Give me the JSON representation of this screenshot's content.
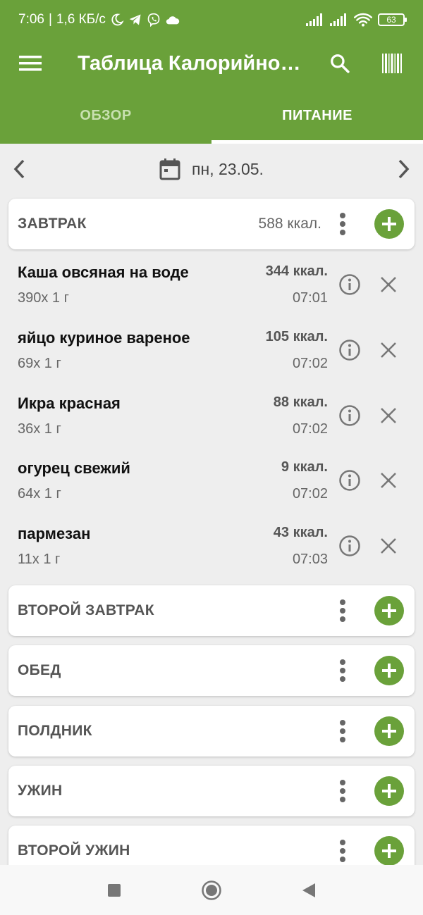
{
  "status": {
    "time": "7:06",
    "speed": "1,6 КБ/с",
    "battery": "63",
    "icons": [
      "moon-icon",
      "telegram-icon",
      "viber-icon",
      "cloud-icon",
      "signal-icon",
      "signal-icon",
      "wifi-icon",
      "battery-icon"
    ]
  },
  "appbar": {
    "title": "Таблица Калорийно…",
    "icons": [
      "menu-icon",
      "search-icon",
      "barcode-icon"
    ]
  },
  "tabs": [
    {
      "label": "ОБЗОР",
      "active": false
    },
    {
      "label": "ПИТАНИЕ",
      "active": true
    }
  ],
  "date": {
    "label": "пн, 23.05."
  },
  "meals": [
    {
      "name": "ЗАВТРАК",
      "kcal": "588 ккал.",
      "items": [
        {
          "name": "Каша овсяная на воде",
          "portion": "390x 1 г",
          "kcal": "344 ккал.",
          "time": "07:01"
        },
        {
          "name": "яйцо куриное вареное",
          "portion": "69x 1 г",
          "kcal": "105 ккал.",
          "time": "07:02"
        },
        {
          "name": "Икра красная",
          "portion": "36x 1 г",
          "kcal": "88 ккал.",
          "time": "07:02"
        },
        {
          "name": "огурец свежий",
          "portion": "64x 1 г",
          "kcal": "9 ккал.",
          "time": "07:02"
        },
        {
          "name": "пармезан",
          "portion": "11x 1 г",
          "kcal": "43 ккал.",
          "time": "07:03"
        }
      ]
    },
    {
      "name": "ВТОРОЙ ЗАВТРАК",
      "kcal": "",
      "items": []
    },
    {
      "name": "ОБЕД",
      "kcal": "",
      "items": []
    },
    {
      "name": "ПОЛДНИК",
      "kcal": "",
      "items": []
    },
    {
      "name": "УЖИН",
      "kcal": "",
      "items": []
    },
    {
      "name": "ВТОРОЙ УЖИН",
      "kcal": "",
      "items": []
    }
  ],
  "colors": {
    "primary": "#6aa13a",
    "background": "#eeeeee"
  }
}
